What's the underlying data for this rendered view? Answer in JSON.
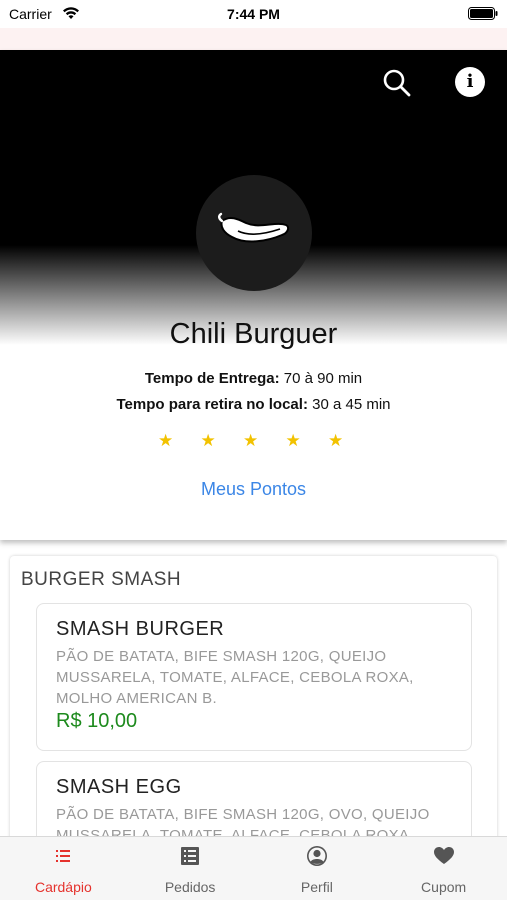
{
  "status_bar": {
    "carrier": "Carrier",
    "time": "7:44 PM"
  },
  "store": {
    "name": "Chili Burguer",
    "delivery_label": "Tempo de Entrega:",
    "delivery_value": "70 à 90 min",
    "pickup_label": "Tempo para retira no local:",
    "pickup_value": "30 a 45 min",
    "rating_stars": 5,
    "points_link": "Meus Pontos"
  },
  "header_icons": {
    "search": "search-icon",
    "info": "info-icon"
  },
  "menu": {
    "section_title": "BURGER SMASH",
    "items": [
      {
        "name": "SMASH BURGER",
        "description": "PÃO DE BATATA, BIFE SMASH 120G, QUEIJO MUSSARELA, TOMATE, ALFACE, CEBOLA ROXA, MOLHO AMERICAN B.",
        "price": "R$ 10,00"
      },
      {
        "name": "SMASH EGG",
        "description": "PÃO DE BATATA, BIFE SMASH 120G, OVO, QUEIJO MUSSARELA, TOMATE, ALFACE, CEBOLA ROXA,"
      }
    ]
  },
  "tabs": [
    {
      "label": "Cardápio",
      "icon": "list-icon",
      "active": true
    },
    {
      "label": "Pedidos",
      "icon": "orders-icon",
      "active": false
    },
    {
      "label": "Perfil",
      "icon": "profile-icon",
      "active": false
    },
    {
      "label": "Cupom",
      "icon": "heart-icon",
      "active": false
    }
  ],
  "colors": {
    "accent_red": "#e5322d",
    "link_blue": "#3b86e6",
    "price_green": "#1d8a1d",
    "star_gold": "#f2c200"
  }
}
